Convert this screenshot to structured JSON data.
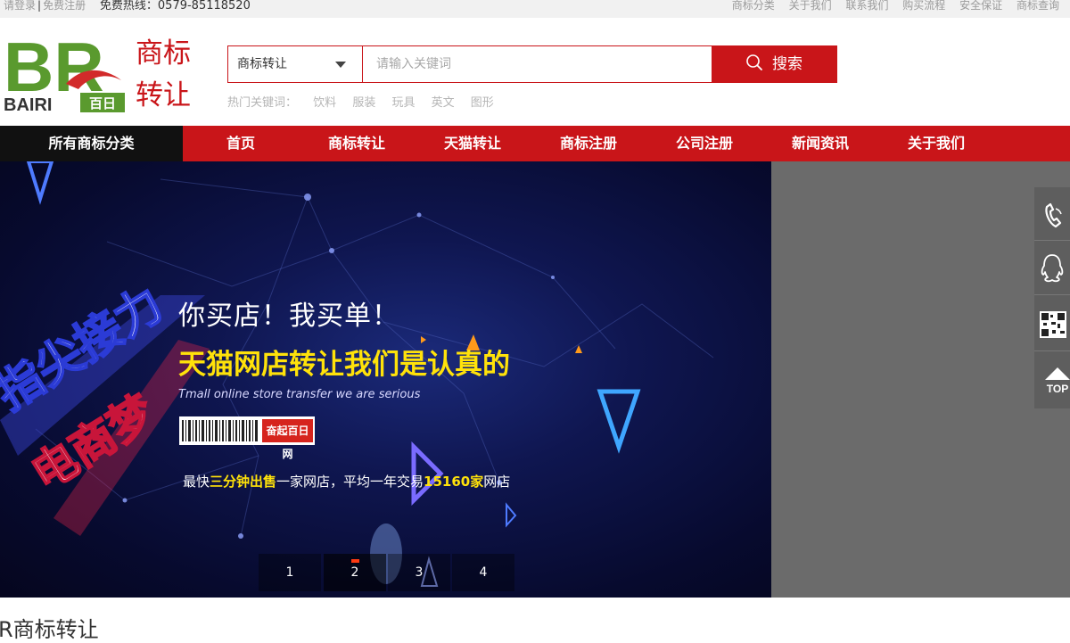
{
  "topbar": {
    "login": "请登录",
    "separator": "|",
    "register": "免费注册",
    "hotline": "免费热线：0579-85118520",
    "links": [
      "商标分类",
      "关于我们",
      "联系我们",
      "购买流程",
      "安全保证",
      "商标查询"
    ]
  },
  "logo": {
    "letters": "BR",
    "brand_en": "BAIRI",
    "brand_cn": "百日",
    "line1": "商标",
    "line2": "转让"
  },
  "search": {
    "category": "商标转让",
    "placeholder": "请输入关键词",
    "button": "搜索"
  },
  "hot": {
    "label": "热门关键词：",
    "keywords": [
      "饮料",
      "服装",
      "玩具",
      "英文",
      "图形"
    ]
  },
  "nav": {
    "all_categories": "所有商标分类",
    "items": [
      "首页",
      "商标转让",
      "天猫转让",
      "商标注册",
      "公司注册",
      "新闻资讯",
      "关于我们"
    ]
  },
  "banner": {
    "art_text1": "指尖接力",
    "art_text2": "电商梦",
    "slogan1": "你买店！我买单！",
    "slogan2": "天猫网店转让我们是认真的",
    "english": "Tmall online store transfer we are serious",
    "stamp": "奋起百日网",
    "stat_pre": "最快",
    "stat_hl1": "三分钟出售",
    "stat_mid": "一家网店，平均一年交易",
    "stat_hl2": "15160家",
    "stat_post": "网店",
    "slides": [
      "1",
      "2",
      "3",
      "4"
    ],
    "active_slide": 2
  },
  "tools": {
    "icons": [
      "phone-icon",
      "qq-icon",
      "qrcode-icon",
      "back-to-top-icon"
    ],
    "top_label": "TOP"
  },
  "section_title": "R商标转让",
  "colors": {
    "brand_red": "#c91519",
    "nav_dark": "#111111",
    "logo_green": "#5a9a2e",
    "highlight_yellow": "#ffe20a"
  }
}
